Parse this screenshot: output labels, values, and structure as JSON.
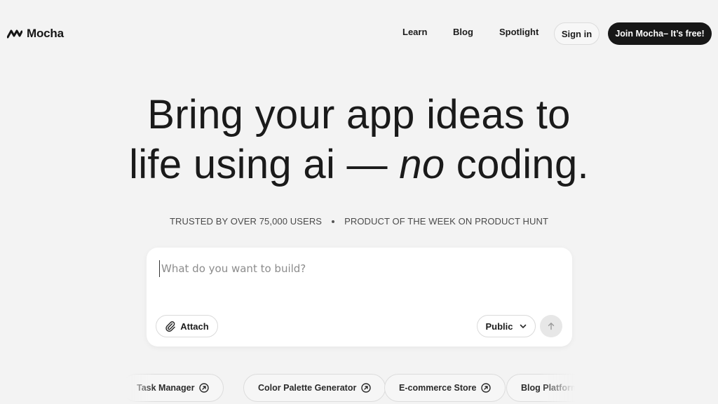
{
  "header": {
    "brand": "Mocha",
    "nav": [
      {
        "label": "Learn"
      },
      {
        "label": "Blog"
      },
      {
        "label": "Spotlight"
      }
    ],
    "signin_label": "Sign in",
    "join_label": "Join Mocha– It’s free!"
  },
  "hero": {
    "line1": "Bring your app ideas to",
    "line2_start": "life using ai — ",
    "line2_em": "no",
    "line2_end": " coding."
  },
  "trust": {
    "left": "TRUSTED BY OVER 75,000 USERS",
    "right": "PRODUCT OF THE WEEK ON PRODUCT HUNT"
  },
  "prompt": {
    "placeholder": "What do you want to build?",
    "value": "",
    "attach_label": "Attach",
    "visibility_label": "Public"
  },
  "suggestions": [
    {
      "label": "Task Manager"
    },
    {
      "label": "Color Palette Generator"
    },
    {
      "label": "E-commerce Store"
    },
    {
      "label": "Blog Platform"
    }
  ],
  "icons": {
    "logo": "mocha-logo-icon",
    "attach": "paperclip-icon",
    "dropdown": "chevron-down-icon",
    "send": "arrow-up-icon",
    "chip": "arrow-up-right-circle-icon"
  },
  "colors": {
    "background": "#f3f3f3",
    "primary_button": "#171717",
    "card": "#ffffff"
  }
}
